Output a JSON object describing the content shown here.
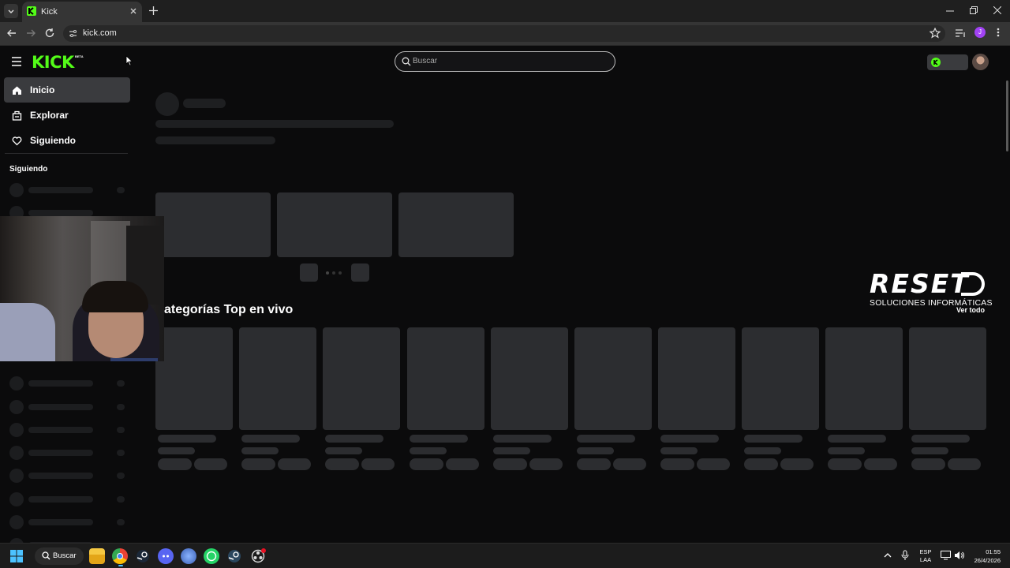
{
  "browser": {
    "tab_title": "Kick",
    "url": "kick.com",
    "profile_initial": "J"
  },
  "header": {
    "logo_text": "KICK",
    "beta_label": "BETA",
    "search_placeholder": "Buscar"
  },
  "sidebar": {
    "items": [
      {
        "label": "Inicio",
        "icon": "home-icon"
      },
      {
        "label": "Explorar",
        "icon": "explore-icon"
      },
      {
        "label": "Siguiendo",
        "icon": "heart-icon"
      }
    ],
    "following_heading": "Siguiendo"
  },
  "main": {
    "categories_title": "ategorías Top en vivo",
    "see_all": "Ver todo"
  },
  "watermark": {
    "brand": "RESET",
    "tagline": "SOLUCIONES INFORMÁTICAS"
  },
  "taskbar": {
    "search_label": "Buscar",
    "lang_top": "ESP",
    "lang_bottom": "LAA",
    "time": "01:55",
    "date": "26/4/2026"
  },
  "colors": {
    "kick_green": "#53fc18",
    "bg": "#0b0b0c",
    "skeleton": "#2c2d30"
  }
}
